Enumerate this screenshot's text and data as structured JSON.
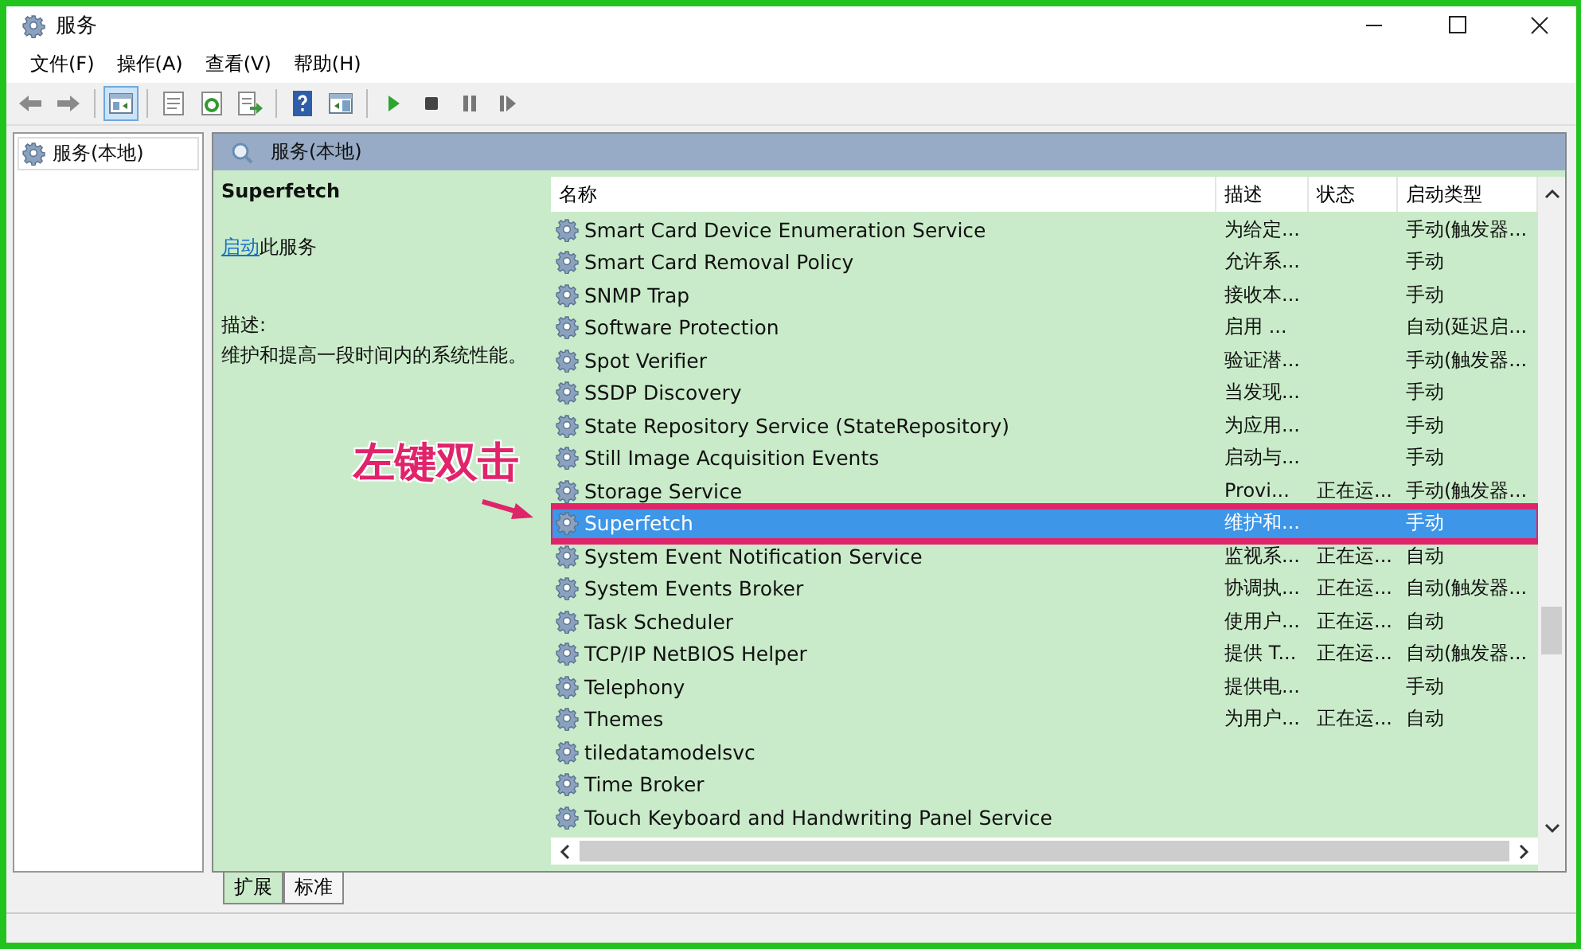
{
  "window": {
    "title": "服务"
  },
  "menu": [
    "文件(F)",
    "操作(A)",
    "查看(V)",
    "帮助(H)"
  ],
  "toolbar": [
    {
      "kind": "back"
    },
    {
      "kind": "forward"
    },
    {
      "kind": "sep"
    },
    {
      "kind": "tree",
      "selected": true
    },
    {
      "kind": "sep"
    },
    {
      "kind": "properties"
    },
    {
      "kind": "refresh"
    },
    {
      "kind": "export"
    },
    {
      "kind": "sep"
    },
    {
      "kind": "help"
    },
    {
      "kind": "view"
    },
    {
      "kind": "sep"
    },
    {
      "kind": "play"
    },
    {
      "kind": "stop"
    },
    {
      "kind": "pause"
    },
    {
      "kind": "resume"
    }
  ],
  "tree": {
    "items": [
      {
        "label": "服务(本地)",
        "selected": false
      }
    ]
  },
  "panel": {
    "title": "服务(本地)"
  },
  "detail": {
    "name": "Superfetch",
    "action_link": "启动",
    "action_rest": "此服务",
    "description_label": "描述:",
    "description": "维护和提高一段时间内的系统性能。"
  },
  "table": {
    "columns": [
      "名称",
      "描述",
      "状态",
      "启动类型"
    ],
    "rows": [
      {
        "name": "Smart Card Device Enumeration Service",
        "description": "为给定...",
        "status": "",
        "startup": "手动(触发器...",
        "selected": false
      },
      {
        "name": "Smart Card Removal Policy",
        "description": "允许系...",
        "status": "",
        "startup": "手动",
        "selected": false
      },
      {
        "name": "SNMP Trap",
        "description": "接收本...",
        "status": "",
        "startup": "手动",
        "selected": false
      },
      {
        "name": "Software Protection",
        "description": "启用 ...",
        "status": "",
        "startup": "自动(延迟启...",
        "selected": false
      },
      {
        "name": "Spot Verifier",
        "description": "验证潜...",
        "status": "",
        "startup": "手动(触发器...",
        "selected": false
      },
      {
        "name": "SSDP Discovery",
        "description": "当发现...",
        "status": "",
        "startup": "手动",
        "selected": false
      },
      {
        "name": "State Repository Service (StateRepository)",
        "description": "为应用...",
        "status": "",
        "startup": "手动",
        "selected": false
      },
      {
        "name": "Still Image Acquisition Events",
        "description": "启动与...",
        "status": "",
        "startup": "手动",
        "selected": false
      },
      {
        "name": "Storage Service",
        "description": "Provi...",
        "status": "正在运...",
        "startup": "手动(触发器...",
        "selected": false
      },
      {
        "name": "Superfetch",
        "description": "维护和...",
        "status": "",
        "startup": "手动",
        "selected": true
      },
      {
        "name": "System Event Notification Service",
        "description": "监视系...",
        "status": "正在运...",
        "startup": "自动",
        "selected": false
      },
      {
        "name": "System Events Broker",
        "description": "协调执...",
        "status": "正在运...",
        "startup": "自动(触发器...",
        "selected": false
      },
      {
        "name": "Task Scheduler",
        "description": "使用户...",
        "status": "正在运...",
        "startup": "自动",
        "selected": false
      },
      {
        "name": "TCP/IP NetBIOS Helper",
        "description": "提供 T...",
        "status": "正在运...",
        "startup": "自动(触发器...",
        "selected": false
      },
      {
        "name": "Telephony",
        "description": "提供电...",
        "status": "",
        "startup": "手动",
        "selected": false
      },
      {
        "name": "Themes",
        "description": "为用户...",
        "status": "正在运...",
        "startup": "自动",
        "selected": false
      },
      {
        "name": "tiledatamodelsvc",
        "description": "",
        "status": "",
        "startup": "",
        "selected": false
      },
      {
        "name": "Time Broker",
        "description": "",
        "status": "",
        "startup": "",
        "selected": false
      },
      {
        "name": "Touch Keyboard and Handwriting Panel Service",
        "description": "",
        "status": "",
        "startup": "",
        "selected": false
      }
    ]
  },
  "tabs": [
    {
      "label": "扩展",
      "selected": true
    },
    {
      "label": "标准",
      "selected": false
    }
  ],
  "annotation": {
    "text": "左键双击"
  }
}
